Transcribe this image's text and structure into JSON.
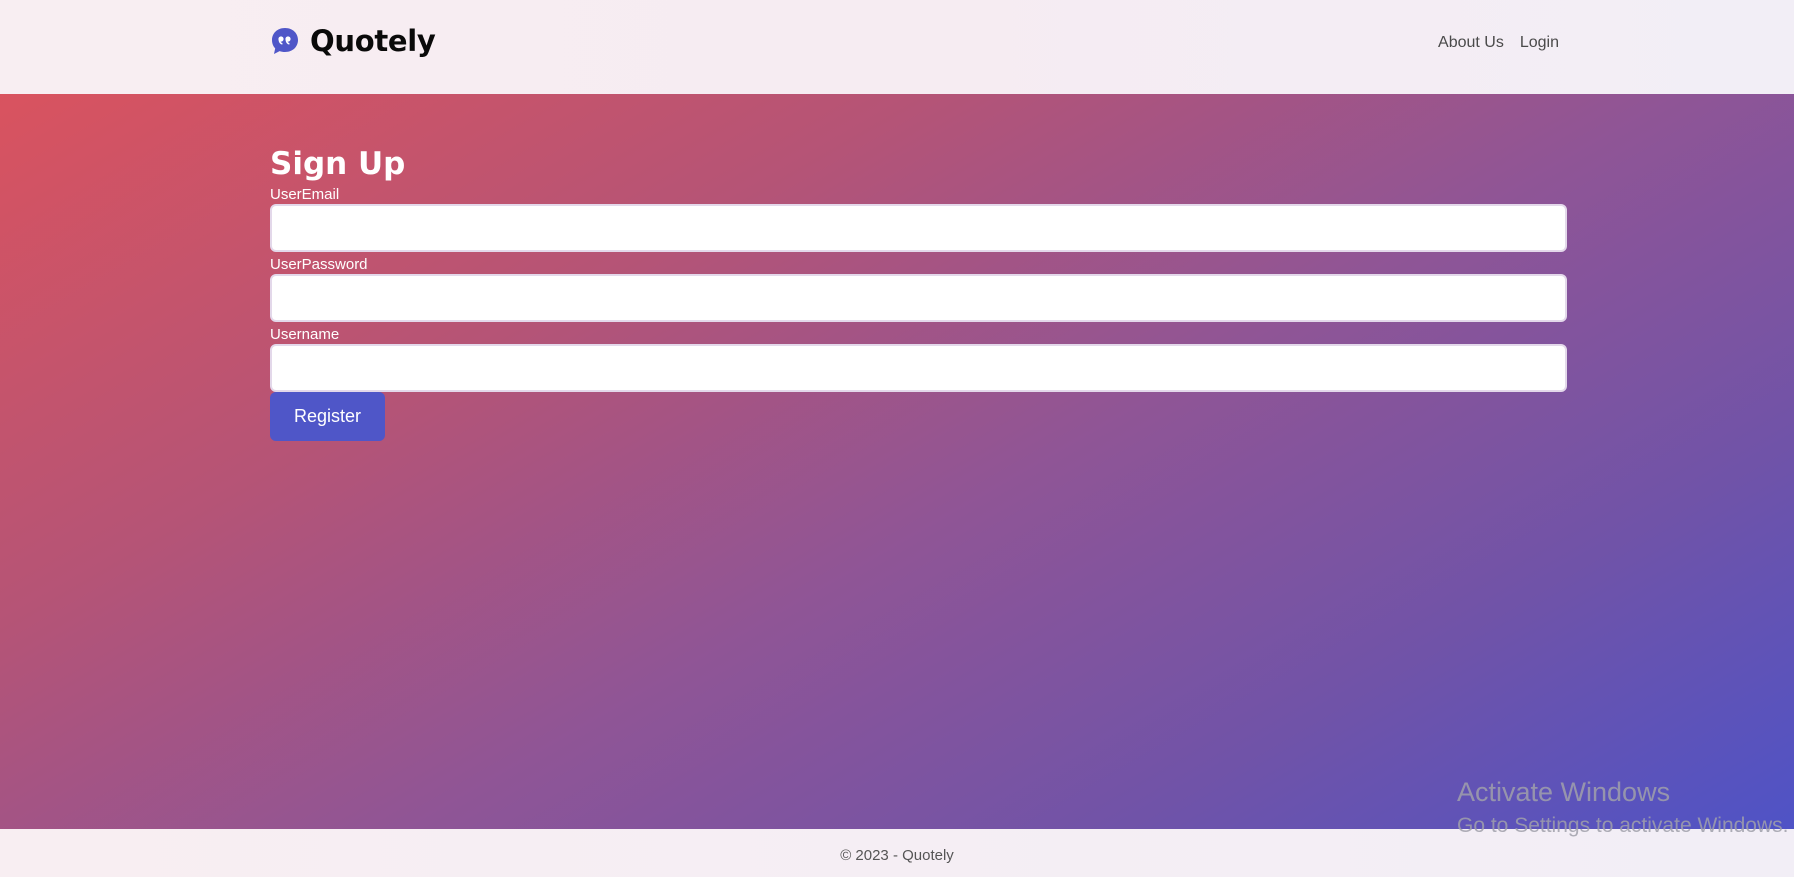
{
  "header": {
    "brand_name": "Quotely",
    "brand_icon": "quote-bubble-icon",
    "nav": [
      {
        "label": "About Us"
      },
      {
        "label": "Login"
      }
    ]
  },
  "signup": {
    "title": "Sign Up",
    "fields": [
      {
        "label": "UserEmail",
        "value": ""
      },
      {
        "label": "UserPassword",
        "value": ""
      },
      {
        "label": "Username",
        "value": ""
      }
    ],
    "submit_label": "Register"
  },
  "footer": {
    "text": "© 2023 - Quotely"
  },
  "watermark": {
    "title": "Activate Windows",
    "subtitle": "Go to Settings to activate Windows."
  },
  "colors": {
    "brand_accent": "#4f56c8",
    "gradient_start": "#d9535f",
    "gradient_end": "#4f53c6"
  }
}
